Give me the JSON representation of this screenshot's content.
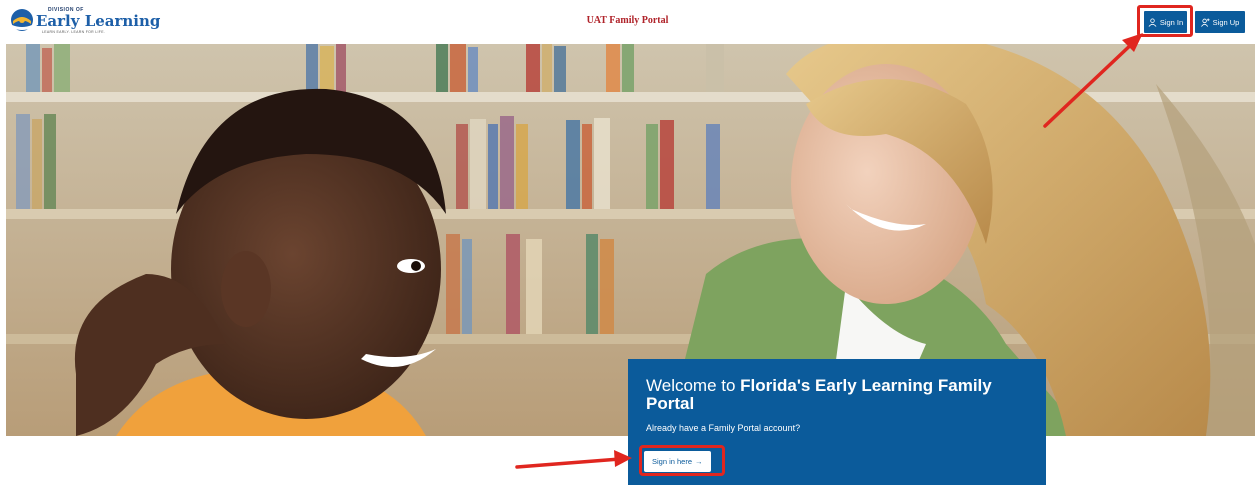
{
  "header": {
    "logo": {
      "small_text": "DIVISION OF",
      "main_text": "Early Learning",
      "tagline": "LEARN EARLY. LEARN FOR LIFE."
    },
    "portal_title": "UAT Family Portal",
    "sign_in_label": "Sign In",
    "sign_up_label": "Sign Up"
  },
  "welcome": {
    "title_prefix": "Welcome to ",
    "title_bold": "Florida's Early Learning Family Portal",
    "subtitle": "Already have a Family Portal account?",
    "sign_in_here_label": "Sign in here",
    "arrow_glyph": "→"
  },
  "colors": {
    "brand_blue": "#0b5b9b",
    "title_red": "#b0232a",
    "highlight_red": "#e0261f"
  },
  "icons": [
    "person-icon",
    "add-person-icon",
    "arrow-right-icon",
    "florida-sun-logo"
  ]
}
